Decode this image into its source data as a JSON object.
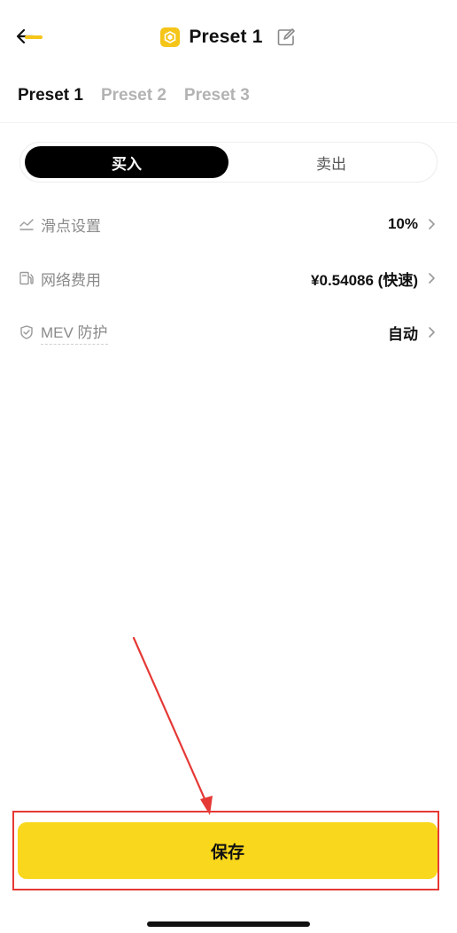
{
  "header": {
    "title": "Preset 1",
    "logo_icon": "coin-logo-icon",
    "back_icon": "arrow-left-icon",
    "edit_icon": "edit-icon"
  },
  "tabs": [
    {
      "label": "Preset 1",
      "active": true
    },
    {
      "label": "Preset 2",
      "active": false
    },
    {
      "label": "Preset 3",
      "active": false
    }
  ],
  "segment": {
    "buy_label": "买入",
    "sell_label": "卖出",
    "selected": "buy"
  },
  "settings": {
    "slippage": {
      "label": "滑点设置",
      "value": "10%",
      "icon": "chart-line-icon"
    },
    "network_fee": {
      "label": "网络费用",
      "value": "¥0.54086 (快速)",
      "icon": "fuel-pump-icon"
    },
    "mev": {
      "label": "MEV 防护",
      "value": "自动",
      "icon": "shield-check-icon"
    }
  },
  "save_button": {
    "label": "保存"
  },
  "colors": {
    "accent": "#F9D71C",
    "highlight": "#E53935",
    "segment_active_bg": "#000000"
  }
}
